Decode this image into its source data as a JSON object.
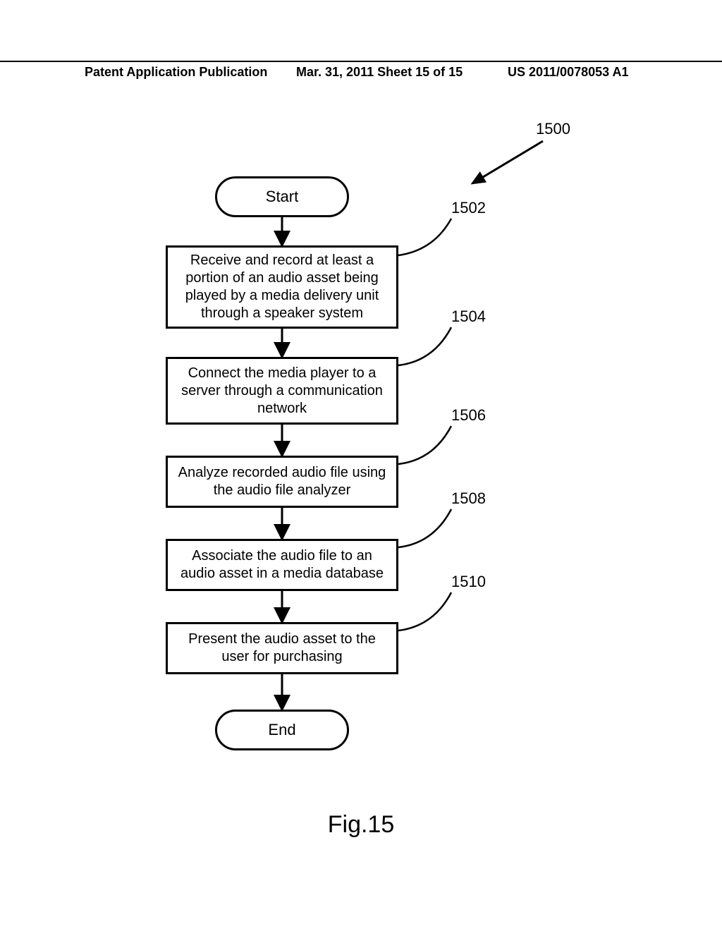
{
  "header": {
    "left": "Patent Application Publication",
    "mid": "Mar. 31, 2011  Sheet 15 of 15",
    "right": "US 2011/0078053 A1"
  },
  "chart_data": {
    "type": "flowchart",
    "title": "Fig.15",
    "reference_numeral": "1500",
    "nodes": [
      {
        "id": "start",
        "shape": "terminator",
        "label": "Start"
      },
      {
        "id": "step1",
        "shape": "process",
        "ref": "1502",
        "label": "Receive and record at least a portion of an audio asset being played by a media delivery unit through a speaker system"
      },
      {
        "id": "step2",
        "shape": "process",
        "ref": "1504",
        "label": "Connect the media player to a server through a communication network"
      },
      {
        "id": "step3",
        "shape": "process",
        "ref": "1506",
        "label": "Analyze recorded audio file using the audio file analyzer"
      },
      {
        "id": "step4",
        "shape": "process",
        "ref": "1508",
        "label": "Associate the audio file to an audio asset in a media database"
      },
      {
        "id": "step5",
        "shape": "process",
        "ref": "1510",
        "label": "Present the audio asset to the user for purchasing"
      },
      {
        "id": "end",
        "shape": "terminator",
        "label": "End"
      }
    ],
    "edges": [
      [
        "start",
        "step1"
      ],
      [
        "step1",
        "step2"
      ],
      [
        "step2",
        "step3"
      ],
      [
        "step3",
        "step4"
      ],
      [
        "step4",
        "step5"
      ],
      [
        "step5",
        "end"
      ]
    ]
  },
  "flow": {
    "start": "Start",
    "end": "End",
    "ref_main": "1500",
    "steps": [
      {
        "ref": "1502",
        "text": "Receive and record at least a portion of an audio asset being played by a media delivery unit through a speaker system"
      },
      {
        "ref": "1504",
        "text": "Connect the media player to a server through a communication network"
      },
      {
        "ref": "1506",
        "text": "Analyze recorded audio file using the audio file analyzer"
      },
      {
        "ref": "1508",
        "text": "Associate the audio file to an audio asset in a media database"
      },
      {
        "ref": "1510",
        "text": "Present the audio asset to the user for purchasing"
      }
    ],
    "figure_label": "Fig.15"
  }
}
